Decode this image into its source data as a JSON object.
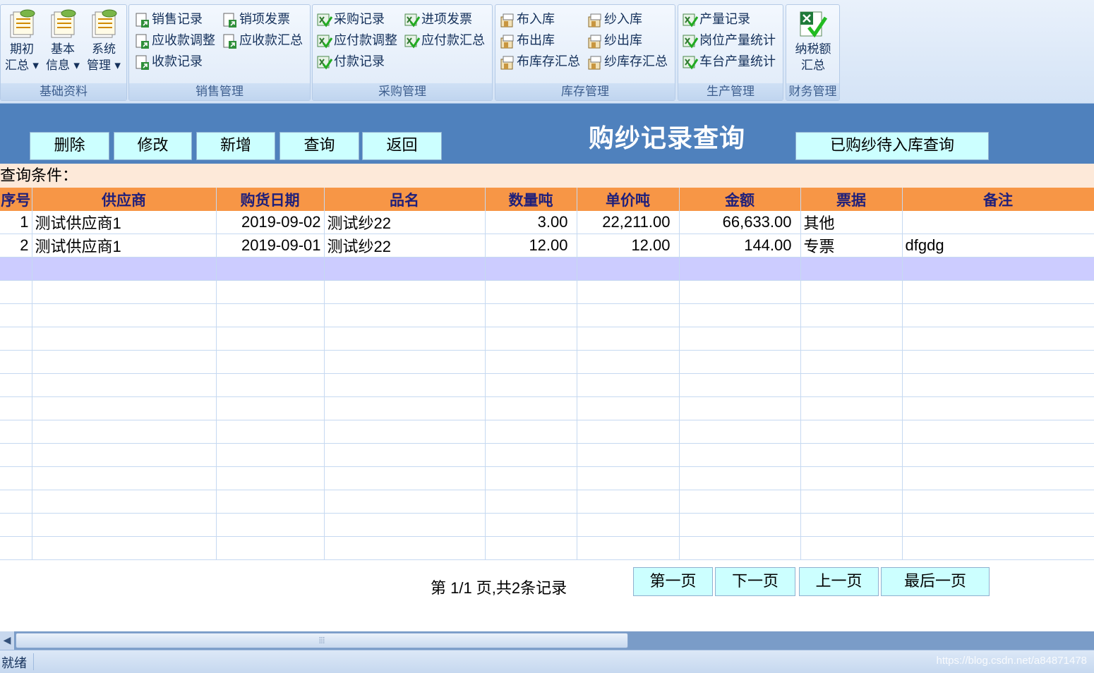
{
  "ribbon": {
    "groups": [
      {
        "title": "基础资料",
        "big_buttons": [
          {
            "label": "期初\n汇总 ▾",
            "icon": "documents-coins-icon"
          },
          {
            "label": "基本\n信息 ▾",
            "icon": "documents-coins-icon"
          },
          {
            "label": "系统\n管理 ▾",
            "icon": "documents-coins-icon"
          }
        ]
      },
      {
        "title": "销售管理",
        "items": [
          {
            "label": "销售记录",
            "icon": "sheet-arrow-icon"
          },
          {
            "label": "销项发票",
            "icon": "sheet-arrow-icon"
          },
          {
            "label": "应收款调整",
            "icon": "sheet-arrow-icon"
          },
          {
            "label": "应收款汇总",
            "icon": "sheet-arrow-icon"
          },
          {
            "label": "收款记录",
            "icon": "sheet-arrow-icon"
          }
        ]
      },
      {
        "title": "采购管理",
        "items": [
          {
            "label": "采购记录",
            "icon": "excel-check-icon"
          },
          {
            "label": "进项发票",
            "icon": "excel-check-icon"
          },
          {
            "label": "应付款调整",
            "icon": "excel-check-icon"
          },
          {
            "label": "应付款汇总",
            "icon": "excel-check-icon"
          },
          {
            "label": "付款记录",
            "icon": "excel-check-icon"
          }
        ]
      },
      {
        "title": "库存管理",
        "items": [
          {
            "label": "布入库",
            "icon": "warehouse-icon"
          },
          {
            "label": "纱入库",
            "icon": "warehouse-icon"
          },
          {
            "label": "布出库",
            "icon": "warehouse-icon"
          },
          {
            "label": "纱出库",
            "icon": "warehouse-icon"
          },
          {
            "label": "布库存汇总",
            "icon": "warehouse-icon"
          },
          {
            "label": "纱库存汇总",
            "icon": "warehouse-icon"
          }
        ]
      },
      {
        "title": "生产管理",
        "items": [
          {
            "label": "产量记录",
            "icon": "excel-check-icon"
          },
          {
            "label": "岗位产量统计",
            "icon": "excel-check-icon"
          },
          {
            "label": "车台产量统计",
            "icon": "excel-check-icon"
          }
        ]
      },
      {
        "title": "财务管理",
        "big_buttons": [
          {
            "label": "纳税额\n汇总",
            "icon": "excel-check-icon"
          }
        ]
      }
    ]
  },
  "toolbar": {
    "delete_label": "删除",
    "edit_label": "修改",
    "add_label": "新增",
    "query_label": "查询",
    "back_label": "返回",
    "pending_label": "已购纱待入库查询"
  },
  "page_title": "购纱记录查询",
  "query_condition_label": "查询条件：",
  "table": {
    "headers": [
      "序号",
      "供应商",
      "购货日期",
      "品名",
      "数量吨",
      "单价吨",
      "金额",
      "票据",
      "备注"
    ],
    "rows": [
      [
        "1",
        "测试供应商1",
        "2019-09-02",
        "测试纱22",
        "3.00",
        "22,211.00",
        "66,633.00",
        "其他",
        ""
      ],
      [
        "2",
        "测试供应商1",
        "2019-09-01",
        "测试纱22",
        "12.00",
        "12.00",
        "144.00",
        "专票",
        "dfgdg"
      ]
    ]
  },
  "pager": {
    "info": "第 1/1 页,共2条记录",
    "first_label": "第一页",
    "next_label": "下一页",
    "prev_label": "上一页",
    "last_label": "最后一页"
  },
  "status": {
    "text": "就绪",
    "watermark": "https://blog.csdn.net/a84871478"
  },
  "colors": {
    "header_bg": "#4f81bd",
    "button_bg": "#ccffff",
    "table_header_bg": "#f79646",
    "selected_row_bg": "#ccccff",
    "query_bar_bg": "#fde9d9"
  }
}
